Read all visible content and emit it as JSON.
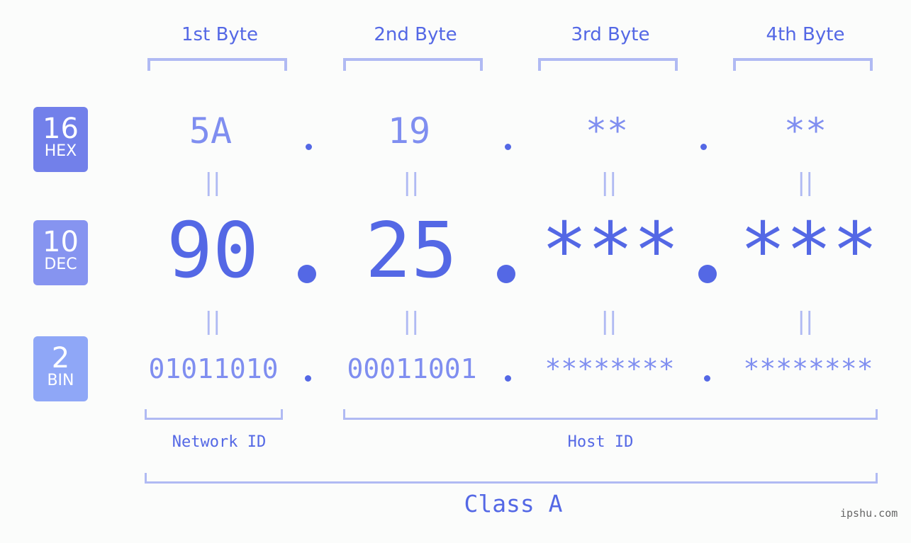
{
  "byte_headers": [
    "1st Byte",
    "2nd Byte",
    "3rd Byte",
    "4th Byte"
  ],
  "badges": [
    {
      "number": "16",
      "label": "HEX",
      "color": "#7280ea"
    },
    {
      "number": "10",
      "label": "DEC",
      "color": "#8694f0"
    },
    {
      "number": "2",
      "label": "BIN",
      "color": "#8fa7f7"
    }
  ],
  "hex": [
    "5A",
    "19",
    "**",
    "**"
  ],
  "dec": [
    "90",
    "25",
    "***",
    "***"
  ],
  "bin": [
    "01011010",
    "00011001",
    "********",
    "********"
  ],
  "equals_sign": "||",
  "network_id_label": "Network ID",
  "host_id_label": "Host ID",
  "class_label": "Class A",
  "watermark": "ipshu.com",
  "colors": {
    "accent": "#5468e5",
    "light": "#7f8ef0",
    "bracket": "#b0baf3"
  }
}
